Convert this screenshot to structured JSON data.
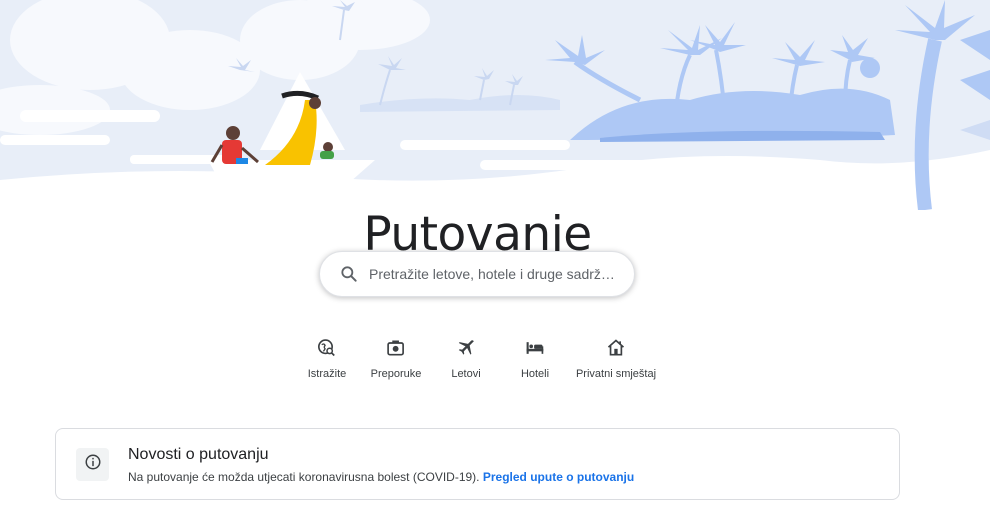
{
  "page": {
    "title": "Putovanje"
  },
  "search": {
    "placeholder": "Pretražite letove, hotele i druge sadržaje"
  },
  "quick_links": [
    {
      "label": "Istražite",
      "icon": "explore-icon"
    },
    {
      "label": "Preporuke",
      "icon": "camera-icon"
    },
    {
      "label": "Letovi",
      "icon": "airplane-icon"
    },
    {
      "label": "Hoteli",
      "icon": "bed-icon"
    },
    {
      "label": "Privatni smještaj",
      "icon": "home-icon"
    }
  ],
  "news": {
    "title": "Novosti o putovanju",
    "text": "Na putovanje će možda utjecati koronavirusna bolest (COVID-19).",
    "link": "Pregled upute o putovanju"
  },
  "colors": {
    "sky": "#eef2fa",
    "island": "#aec8f5",
    "accent_link": "#1a73e8",
    "sail_yellow": "#f9c200",
    "shirt_red": "#e53935"
  }
}
